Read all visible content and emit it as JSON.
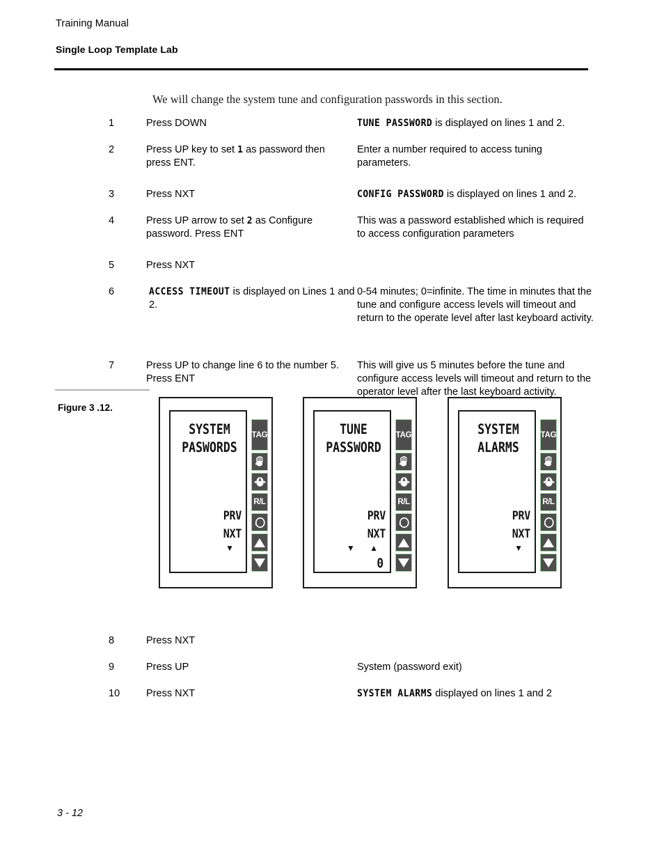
{
  "header": {
    "manual_title": "Training Manual",
    "section_title": "Single Loop Template Lab"
  },
  "intro": "We will change the system tune and configuration passwords in this section.",
  "steps": [
    {
      "num": "1",
      "action": "Press DOWN",
      "result_lcd": "TUNE PASSWORD",
      "result_text": " is displayed on lines 1 and 2."
    },
    {
      "num": "2",
      "action_pre": "Press UP key to set ",
      "action_lcd": "1",
      "action_post": " as password then press ENT.",
      "result_text": "Enter a number required to access tuning parameters."
    },
    {
      "num": "3",
      "action": "Press NXT",
      "result_lcd": "CONFIG PASSWORD",
      "result_text": " is displayed on lines 1 and 2."
    },
    {
      "num": "4",
      "action_pre": "Press UP arrow to set ",
      "action_lcd": "2",
      "action_post": " as Configure password.  Press ENT",
      "result_text": "This was a password established which is required to access configuration parameters"
    },
    {
      "num": "5",
      "action": "Press NXT",
      "result_text": ""
    },
    {
      "num": "6",
      "action_lcd": "ACCESS TIMEOUT",
      "action_post": " is displayed on Lines 1 and 2.",
      "result_text": "0-54 minutes; 0=infinite.  The time in minutes that the tune and configure access levels will timeout and return to the operate level after last keyboard activity."
    },
    {
      "num": "7",
      "action": "Press UP to change line 6 to the number 5. Press ENT",
      "result_text": "This will give us 5 minutes before the tune and configure access levels will timeout and return to the operator level after the last keyboard activity."
    }
  ],
  "steps_after_figure": [
    {
      "num": "8",
      "action": "Press NXT",
      "result_text": ""
    },
    {
      "num": "9",
      "action": "Press UP",
      "result_text": "System (password exit)"
    },
    {
      "num": "10",
      "action": "Press NXT",
      "result_lcd": "SYSTEM ALARMS",
      "result_text": " displayed on lines 1 and 2"
    }
  ],
  "figure": {
    "caption": "Figure 3 .12.",
    "devices": [
      {
        "id": "device-1",
        "screen": {
          "line1": "SYSTEM",
          "line2": "PASWORDS",
          "soft_prv": "PRV",
          "soft_nxt": "NXT",
          "arrows": "▼",
          "value": ""
        }
      },
      {
        "id": "device-2",
        "screen": {
          "line1": "TUNE",
          "line2": "PASSWORD",
          "soft_prv": "PRV",
          "soft_nxt": "NXT",
          "arrows": "▼ ▲",
          "value": "0"
        }
      },
      {
        "id": "device-3",
        "screen": {
          "line1": "SYSTEM",
          "line2": "ALARMS",
          "soft_prv": "PRV",
          "soft_nxt": "NXT",
          "arrows": "▼",
          "value": ""
        }
      }
    ],
    "buttons": [
      {
        "name": "tag-button",
        "label": "TAG",
        "icon": "text"
      },
      {
        "name": "manual-hand-button",
        "label": "",
        "icon": "hand"
      },
      {
        "name": "auto-button",
        "label": "",
        "icon": "auto-a"
      },
      {
        "name": "remote-local-button",
        "label": "R/L",
        "icon": "text"
      },
      {
        "name": "loop-cycle-button",
        "label": "",
        "icon": "circle-arrow"
      },
      {
        "name": "up-button",
        "label": "",
        "icon": "triangle-up"
      },
      {
        "name": "down-button",
        "label": "",
        "icon": "triangle-down"
      }
    ],
    "colors": {
      "button_face": "#4d4d4d",
      "button_border": "#9ccf9c",
      "button_text": "#ffffff",
      "device_outline": "#1a1a1a"
    }
  },
  "footer": {
    "page_number": "3 - 12"
  }
}
